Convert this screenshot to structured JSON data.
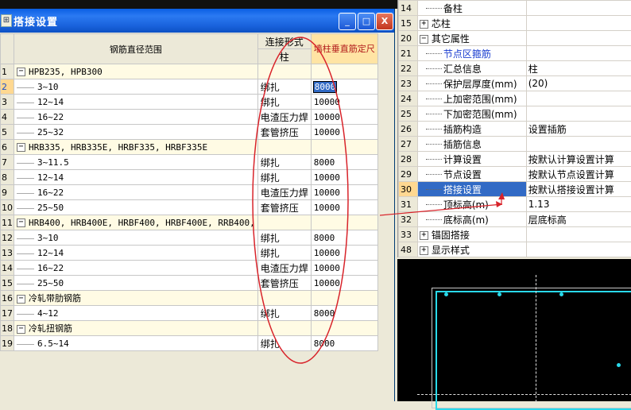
{
  "dialog": {
    "title": "搭接设置",
    "title_icon": "dialog-icon",
    "buttons": {
      "minimize": "_",
      "maximize": "□",
      "close": "X"
    },
    "headers": {
      "range": "钢筋直径范围",
      "conn": "连接形式",
      "conn_sub": "柱",
      "wall": "墙柱垂直筋定尺"
    },
    "rows": [
      {
        "n": "1",
        "group": true,
        "name": "HPB235, HPB300",
        "conn": "",
        "val": ""
      },
      {
        "n": "2",
        "group": false,
        "name": "3~10",
        "conn": "绑扎",
        "val": "8000",
        "editing": true
      },
      {
        "n": "3",
        "group": false,
        "name": "12~14",
        "conn": "绑扎",
        "val": "10000"
      },
      {
        "n": "4",
        "group": false,
        "name": "16~22",
        "conn": "电渣压力焊",
        "val": "10000"
      },
      {
        "n": "5",
        "group": false,
        "name": "25~32",
        "conn": "套管挤压",
        "val": "10000"
      },
      {
        "n": "6",
        "group": true,
        "name": "HRB335, HRB335E, HRBF335, HRBF335E",
        "conn": "",
        "val": ""
      },
      {
        "n": "7",
        "group": false,
        "name": "3~11.5",
        "conn": "绑扎",
        "val": "8000"
      },
      {
        "n": "8",
        "group": false,
        "name": "12~14",
        "conn": "绑扎",
        "val": "10000"
      },
      {
        "n": "9",
        "group": false,
        "name": "16~22",
        "conn": "电渣压力焊",
        "val": "10000"
      },
      {
        "n": "10",
        "group": false,
        "name": "25~50",
        "conn": "套管挤压",
        "val": "10000"
      },
      {
        "n": "11",
        "group": true,
        "name": "HRB400, HRB400E, HRBF400, HRBF400E, RRB400,",
        "conn": "",
        "val": ""
      },
      {
        "n": "12",
        "group": false,
        "name": "3~10",
        "conn": "绑扎",
        "val": "8000"
      },
      {
        "n": "13",
        "group": false,
        "name": "12~14",
        "conn": "绑扎",
        "val": "10000"
      },
      {
        "n": "14",
        "group": false,
        "name": "16~22",
        "conn": "电渣压力焊",
        "val": "10000"
      },
      {
        "n": "15",
        "group": false,
        "name": "25~50",
        "conn": "套管挤压",
        "val": "10000"
      },
      {
        "n": "16",
        "group": true,
        "name": "冷轧带肋钢筋",
        "conn": "",
        "val": ""
      },
      {
        "n": "17",
        "group": false,
        "name": "4~12",
        "conn": "绑扎",
        "val": "8000"
      },
      {
        "n": "18",
        "group": true,
        "name": "冷轧扭钢筋",
        "conn": "",
        "val": ""
      },
      {
        "n": "19",
        "group": false,
        "name": "6.5~14",
        "conn": "绑扎",
        "val": "8000"
      }
    ]
  },
  "props": {
    "rows": [
      {
        "n": "14",
        "name": "备柱",
        "val": "",
        "type": "child"
      },
      {
        "n": "15",
        "name": "芯柱",
        "val": "",
        "type": "plus"
      },
      {
        "n": "20",
        "name": "其它属性",
        "val": "",
        "type": "minus"
      },
      {
        "n": "21",
        "name": "节点区箍筋",
        "val": "",
        "type": "child",
        "blue": true
      },
      {
        "n": "22",
        "name": "汇总信息",
        "val": "柱",
        "type": "child"
      },
      {
        "n": "23",
        "name": "保护层厚度(mm)",
        "val": "(20)",
        "type": "child"
      },
      {
        "n": "24",
        "name": "上加密范围(mm)",
        "val": "",
        "type": "child"
      },
      {
        "n": "25",
        "name": "下加密范围(mm)",
        "val": "",
        "type": "child"
      },
      {
        "n": "26",
        "name": "插筋构造",
        "val": "设置插筋",
        "type": "child"
      },
      {
        "n": "27",
        "name": "插筋信息",
        "val": "",
        "type": "child"
      },
      {
        "n": "28",
        "name": "计算设置",
        "val": "按默认计算设置计算",
        "type": "child"
      },
      {
        "n": "29",
        "name": "节点设置",
        "val": "按默认节点设置计算",
        "type": "child"
      },
      {
        "n": "30",
        "name": "搭接设置",
        "val": "按默认搭接设置计算",
        "type": "child",
        "selected": true
      },
      {
        "n": "31",
        "name": "顶标高(m)",
        "val": "1.13",
        "type": "child"
      },
      {
        "n": "32",
        "name": "底标高(m)",
        "val": "层底标高",
        "type": "child"
      },
      {
        "n": "33",
        "name": "锚固搭接",
        "val": "",
        "type": "plus"
      },
      {
        "n": "48",
        "name": "显示样式",
        "val": "",
        "type": "plus"
      }
    ]
  },
  "colors": {
    "annotation": "#d8232a",
    "accent": "#316ac5",
    "cad_line": "#29d9ea"
  }
}
